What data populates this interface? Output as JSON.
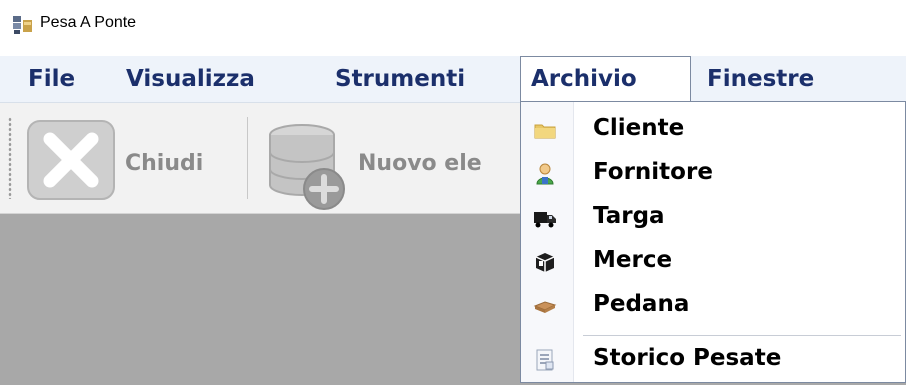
{
  "window": {
    "title": "Pesa A Ponte",
    "icon": "scale-app-icon"
  },
  "menubar": {
    "items": [
      {
        "label": "File"
      },
      {
        "label": "Visualizza"
      },
      {
        "label": "Strumenti"
      },
      {
        "label": "Archivio",
        "open": true
      },
      {
        "label": "Finestre"
      }
    ]
  },
  "toolbar": {
    "buttons": [
      {
        "label": "Chiudi",
        "icon": "close-x-icon",
        "enabled": false
      },
      {
        "label": "Nuovo ele",
        "icon": "new-database-icon",
        "enabled": false
      }
    ]
  },
  "dropdown": {
    "items": [
      {
        "label": "Cliente",
        "icon": "folder-icon"
      },
      {
        "label": "Fornitore",
        "icon": "person-icon"
      },
      {
        "label": "Targa",
        "icon": "truck-icon"
      },
      {
        "label": "Merce",
        "icon": "box-icon"
      },
      {
        "label": "Pedana",
        "icon": "pallet-icon"
      },
      {
        "label": "Storico Pesate",
        "icon": "history-icon"
      }
    ]
  },
  "colors": {
    "menu_text": "#1b2f6b",
    "menubar_bg": "#eef3fa",
    "workspace_bg": "#a8a8a8",
    "toolbar_bg": "#f2f2f2"
  }
}
